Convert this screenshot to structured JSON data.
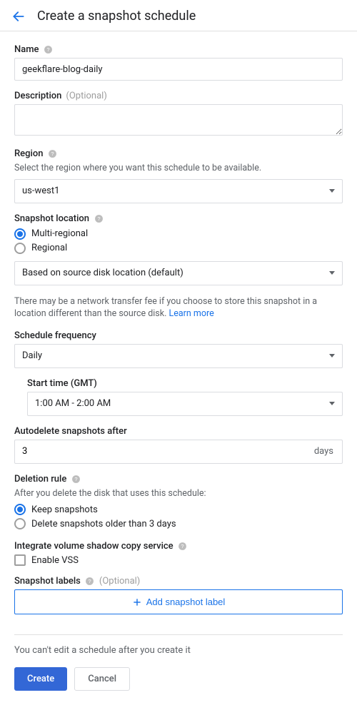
{
  "header": {
    "title": "Create a snapshot schedule"
  },
  "name": {
    "label": "Name",
    "value": "geekflare-blog-daily"
  },
  "description": {
    "label": "Description",
    "optional": "(Optional)",
    "value": ""
  },
  "region": {
    "label": "Region",
    "hint": "Select the region where you want this schedule to be available.",
    "value": "us-west1"
  },
  "snapshot_location": {
    "label": "Snapshot location",
    "options": {
      "multi": "Multi-regional",
      "regional": "Regional"
    },
    "select_value": "Based on source disk location (default)",
    "hint_prefix": "There may be a network transfer fee if you choose to store this snapshot in a location different than the source disk. ",
    "hint_link": "Learn more"
  },
  "schedule_frequency": {
    "label": "Schedule frequency",
    "value": "Daily"
  },
  "start_time": {
    "label": "Start time (GMT)",
    "value": "1:00 AM - 2:00 AM"
  },
  "autodelete": {
    "label": "Autodelete snapshots after",
    "value": "3",
    "unit": "days"
  },
  "deletion_rule": {
    "label": "Deletion rule",
    "hint": "After you delete the disk that uses this schedule:",
    "options": {
      "keep": "Keep snapshots",
      "delete": "Delete snapshots older than 3 days"
    }
  },
  "vss": {
    "label": "Integrate volume shadow copy service",
    "checkbox_label": "Enable VSS"
  },
  "snapshot_labels": {
    "label": "Snapshot labels",
    "optional": "(Optional)",
    "add_button": "Add snapshot label"
  },
  "footer": {
    "note": "You can't edit a schedule after you create it",
    "create": "Create",
    "cancel": "Cancel"
  }
}
